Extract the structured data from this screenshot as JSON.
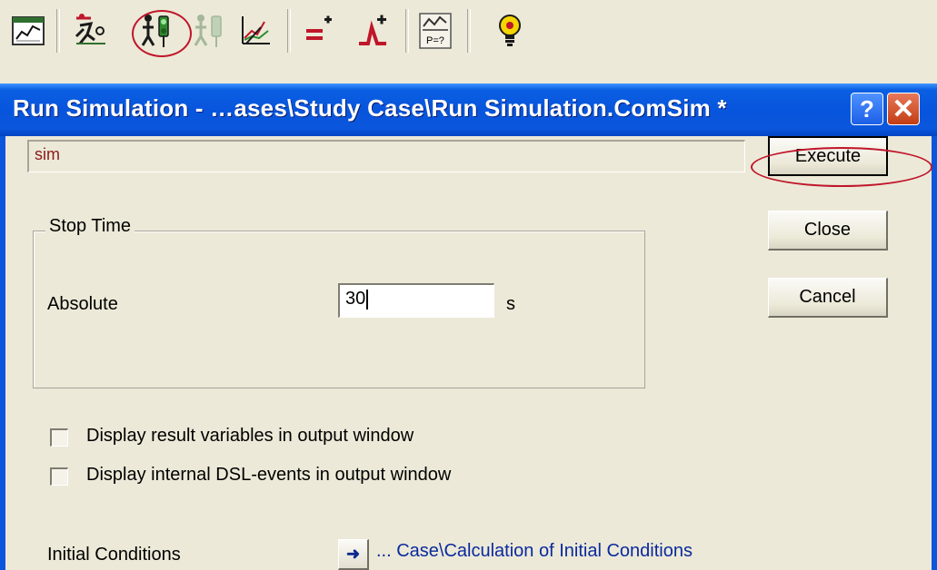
{
  "toolbar": {
    "icons": [
      "chart-window-icon",
      "run-person-icon",
      "start-simulation-icon",
      "stop-simulation-icon",
      "plot-icon",
      "add-equation-icon",
      "add-event-icon",
      "probability-plot-icon",
      "lightbulb-icon"
    ],
    "pplot_label": "P=?"
  },
  "dialog": {
    "title": "Run Simulation - …ases\\Study Case\\Run Simulation.ComSim *",
    "help_label": "?",
    "close_label": "✕",
    "name_value": "sim",
    "execute_label": "Execute",
    "close_button_label": "Close",
    "cancel_label": "Cancel",
    "stop_time": {
      "legend": "Stop Time",
      "absolute_label": "Absolute",
      "value": "30",
      "unit": "s"
    },
    "options": [
      {
        "label": "Display result variables in output window",
        "checked": false
      },
      {
        "label": "Display internal DSL-events in output window",
        "checked": false
      }
    ],
    "initial_conditions": {
      "label": "Initial Conditions",
      "arrow": "➜",
      "link": "... Case\\Calculation of Initial Conditions"
    }
  },
  "colors": {
    "titlebar": "#0a56dc",
    "highlight": "#c0162a",
    "name_text": "#8b1a1a",
    "link_text": "#0a2a9e"
  }
}
